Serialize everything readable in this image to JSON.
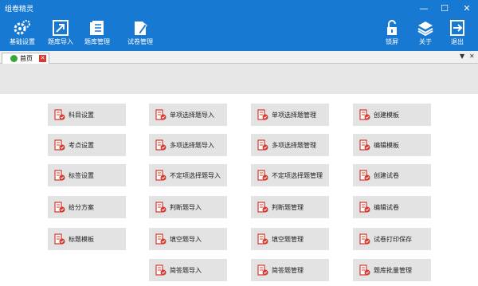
{
  "window": {
    "title": "组卷精灵",
    "controls": [
      "—",
      "☐",
      "✕"
    ]
  },
  "toolbar": {
    "left": [
      {
        "label": "基础设置",
        "icon": "gear-icon"
      },
      {
        "label": "题库导入",
        "icon": "import-icon"
      },
      {
        "label": "题库管理",
        "icon": "document-icon"
      },
      {
        "label": "试卷管理",
        "icon": "edit-document-icon"
      }
    ],
    "right": [
      {
        "label": "锁屏",
        "icon": "lock-icon"
      },
      {
        "label": "关于",
        "icon": "layers-icon"
      },
      {
        "label": "退出",
        "icon": "exit-icon"
      }
    ]
  },
  "tabs": [
    {
      "label": "首页",
      "active": true
    }
  ],
  "tab_controls": {
    "dropdown": "▼",
    "close": "✕"
  },
  "grid": {
    "columns": [
      [
        "科目设置",
        "考点设置",
        "标签设置",
        "给分方案",
        "标题模板"
      ],
      [
        "单项选择题导入",
        "多项选择题导入",
        "不定项选择题导入",
        "判断题导入",
        "填空题导入",
        "简答题导入"
      ],
      [
        "单项选择题管理",
        "多项选择题管理",
        "不定项选择题管理",
        "判断题管理",
        "填空题管理",
        "简答题管理"
      ],
      [
        "创建模板",
        "编辑模板",
        "创建试卷",
        "编辑试卷",
        "试卷打印保存",
        "题库批量管理"
      ]
    ]
  },
  "colors": {
    "titlebar": "#1879d2",
    "tile": "#e3e3e3",
    "icon_red": "#d43a2f"
  }
}
